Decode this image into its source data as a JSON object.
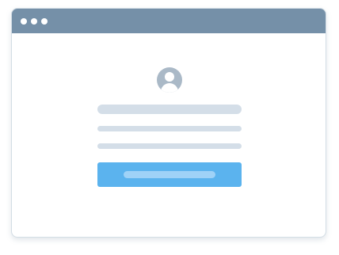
{
  "window": {
    "title_bar_color": "#7590a8",
    "window_controls": [
      "window-dot-icon",
      "window-dot-icon",
      "window-dot-icon"
    ]
  },
  "login_form": {
    "avatar_icon": "user-avatar-icon",
    "text_placeholders": 3,
    "button_color": "#5bb3ee",
    "placeholder_color": "#d4dee8"
  }
}
